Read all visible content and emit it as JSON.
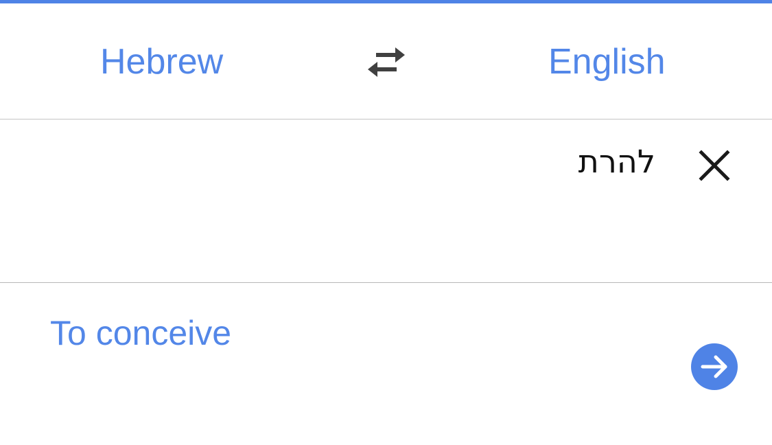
{
  "header": {
    "source_language": "Hebrew",
    "target_language": "English",
    "swap_icon": "swap-arrows-icon"
  },
  "input": {
    "text": "להרת",
    "clear_icon": "close-icon"
  },
  "output": {
    "translation": "To conceive",
    "open_icon": "arrow-right-circle-icon"
  },
  "colors": {
    "accent": "#4f83e6",
    "link": "#5387e8",
    "divider": "#c4c4c4"
  }
}
